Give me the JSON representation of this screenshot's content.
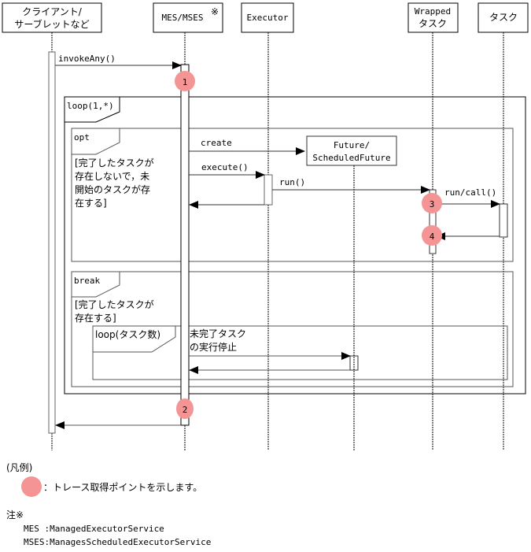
{
  "lifelines": [
    {
      "id": "client",
      "lines": [
        "クライアント/",
        "サーブレットなど"
      ]
    },
    {
      "id": "mes",
      "lines": [
        "MES/MSES"
      ],
      "sup": "※"
    },
    {
      "id": "executor",
      "lines": [
        "Executor"
      ]
    },
    {
      "id": "wrapped",
      "lines": [
        "Wrapped",
        "タスク"
      ]
    },
    {
      "id": "task",
      "lines": [
        "タスク"
      ]
    }
  ],
  "future_object": {
    "lines": [
      "Future/",
      "ScheduledFuture"
    ]
  },
  "messages": {
    "invoke_any": "invokeAny()",
    "create": "create",
    "execute": "execute()",
    "run": "run()",
    "run_call": "run/call()",
    "stop_lines": [
      "未完了タスク",
      "の実行停止"
    ]
  },
  "fragments": {
    "loop_outer": "loop(1,*)",
    "opt": "opt",
    "opt_guard": [
      "[完了したタスクが",
      "存在しないで，未",
      "開始のタスクが存",
      "在する]"
    ],
    "break": "break",
    "break_guard": [
      "[完了したタスクが",
      "存在する]"
    ],
    "loop_inner": "loop(タスク数)"
  },
  "trace_points": [
    "1",
    "2",
    "3",
    "4"
  ],
  "colors": {
    "trace_point": "#f59494",
    "frame": "#707070",
    "line": "#000000"
  },
  "legend": {
    "title": "(凡例)",
    "trace_desc": "：トレース取得ポイントを示します。",
    "note_title": "注※",
    "notes": [
      "MES :ManagedExecutorService",
      "MSES:ManagesScheduledExecutorService"
    ]
  }
}
